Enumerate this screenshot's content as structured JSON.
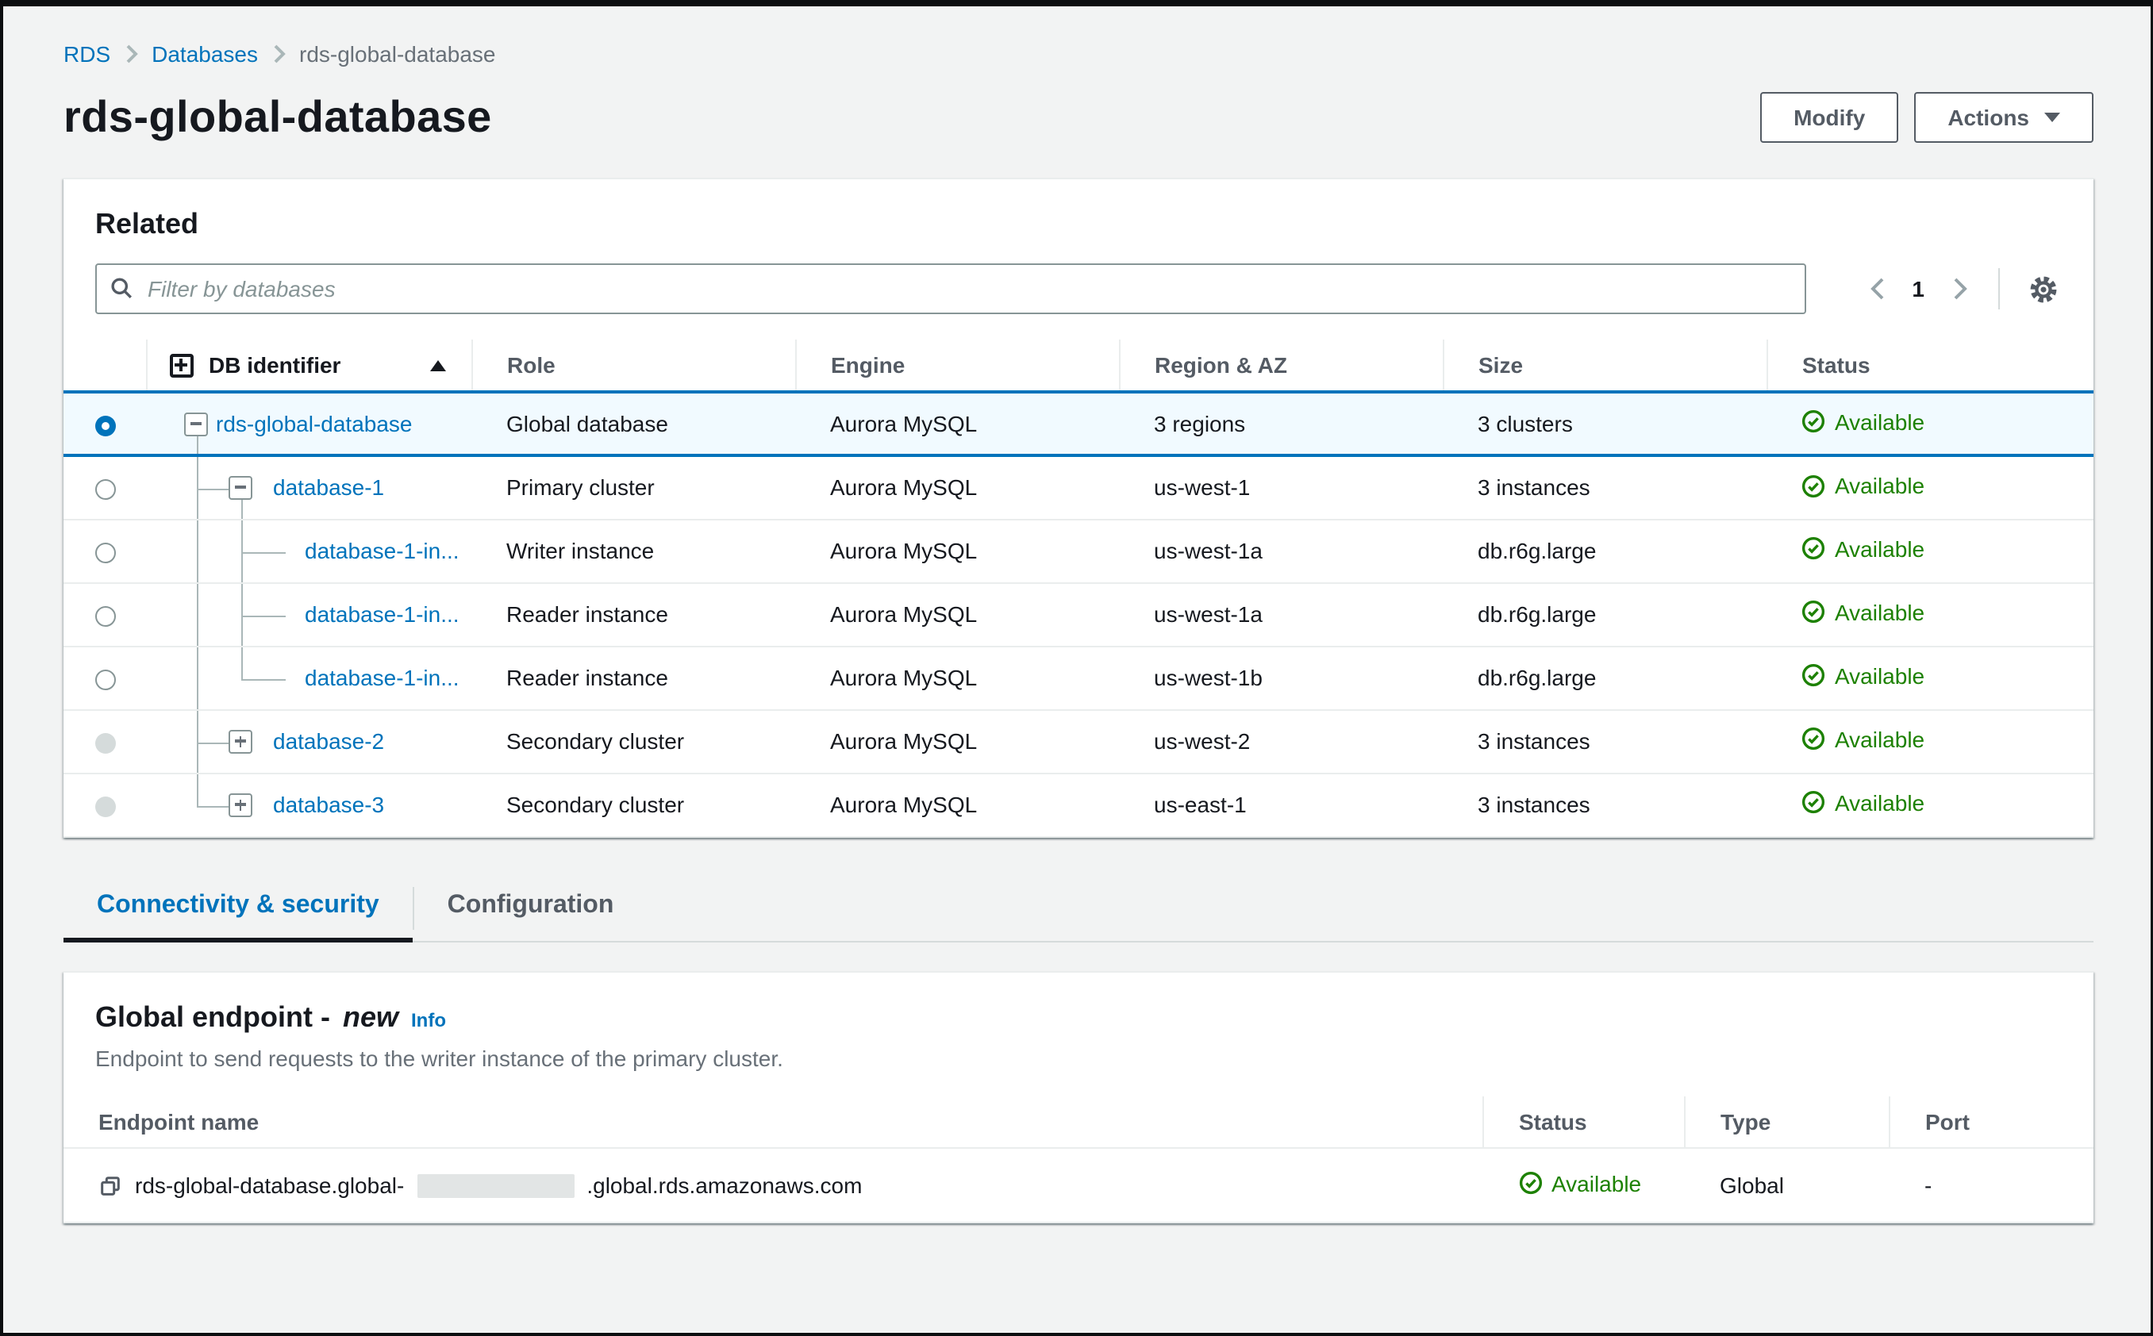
{
  "colors": {
    "background": "#f2f3f3",
    "accent_link_blue": "#0073bb",
    "status_green": "#1d8102",
    "selected_row_bg": "#f1faff",
    "frame_black": "#0c0e10"
  },
  "icons": {
    "breadcrumb_separator": "chevron-right",
    "search": "magnifying-glass",
    "previous_page": "chevron-left",
    "next_page": "chevron-right",
    "settings": "gear",
    "expand_all": "plus-square",
    "sort_ascending": "triangle-up",
    "actions_caret": "triangle-down",
    "collapse_row": "minus-square",
    "expand_row": "plus-square",
    "status_available": "check-circle",
    "copy": "copy-squares"
  },
  "breadcrumb": {
    "items": [
      {
        "label": "RDS"
      },
      {
        "label": "Databases"
      }
    ],
    "current": "rds-global-database"
  },
  "header": {
    "title": "rds-global-database",
    "modify_label": "Modify",
    "actions_label": "Actions"
  },
  "related": {
    "heading": "Related",
    "filter_placeholder": "Filter by databases",
    "pagination": {
      "page": "1"
    },
    "table": {
      "columns": [
        "DB identifier",
        "Role",
        "Engine",
        "Region & AZ",
        "Size",
        "Status"
      ],
      "rows": [
        {
          "id": "rds-global-database",
          "role": "Global database",
          "engine": "Aurora MySQL",
          "region": "3 regions",
          "size": "3 clusters",
          "status": "Available",
          "level": 1,
          "expander": "minus",
          "radio": "selected"
        },
        {
          "id": "database-1",
          "role": "Primary cluster",
          "engine": "Aurora MySQL",
          "region": "us-west-1",
          "size": "3 instances",
          "status": "Available",
          "level": 2,
          "expander": "minus",
          "radio": "empty"
        },
        {
          "id": "database-1-in...",
          "role": "Writer instance",
          "engine": "Aurora MySQL",
          "region": "us-west-1a",
          "size": "db.r6g.large",
          "status": "Available",
          "level": 3,
          "expander": "none",
          "radio": "empty"
        },
        {
          "id": "database-1-in...",
          "role": "Reader instance",
          "engine": "Aurora MySQL",
          "region": "us-west-1a",
          "size": "db.r6g.large",
          "status": "Available",
          "level": 3,
          "expander": "none",
          "radio": "empty"
        },
        {
          "id": "database-1-in...",
          "role": "Reader instance",
          "engine": "Aurora MySQL",
          "region": "us-west-1b",
          "size": "db.r6g.large",
          "status": "Available",
          "level": 3,
          "expander": "none",
          "radio": "empty"
        },
        {
          "id": "database-2",
          "role": "Secondary cluster",
          "engine": "Aurora MySQL",
          "region": "us-west-2",
          "size": "3 instances",
          "status": "Available",
          "level": 2,
          "expander": "plus",
          "radio": "disabled"
        },
        {
          "id": "database-3",
          "role": "Secondary cluster",
          "engine": "Aurora MySQL",
          "region": "us-east-1",
          "size": "3 instances",
          "status": "Available",
          "level": 2,
          "expander": "plus",
          "radio": "disabled"
        }
      ]
    }
  },
  "tabs": [
    {
      "label": "Connectivity & security",
      "active": true
    },
    {
      "label": "Configuration",
      "active": false
    }
  ],
  "endpoint_section": {
    "title": "Global endpoint -",
    "title_em": "new",
    "info_label": "Info",
    "description": "Endpoint to send requests to the writer instance of the primary cluster.",
    "table": {
      "columns": [
        "Endpoint name",
        "Status",
        "Type",
        "Port"
      ],
      "row": {
        "name_prefix": "rds-global-database.global-",
        "name_redacted": true,
        "name_suffix": ".global.rds.amazonaws.com",
        "status": "Available",
        "type": "Global",
        "port": "-"
      }
    }
  }
}
